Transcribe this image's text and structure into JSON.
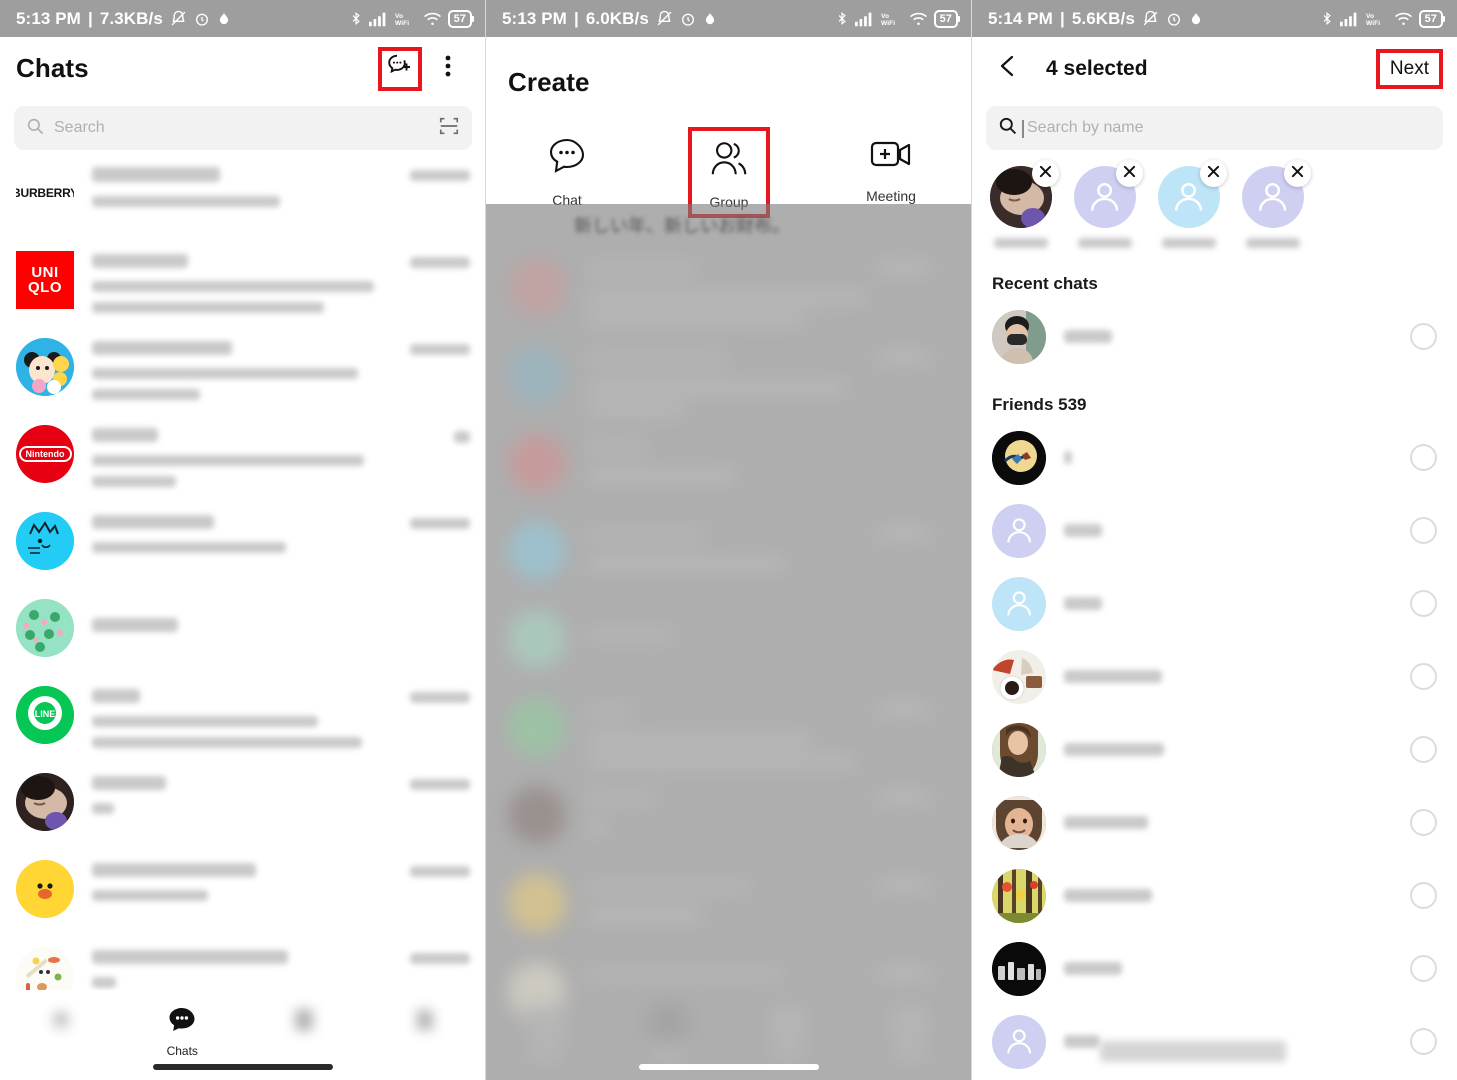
{
  "panels": [
    {
      "id": "chats",
      "status_bar": {
        "time": "5:13 PM",
        "separator": "|",
        "network_speed": "7.3KB/s",
        "icons_left": [
          "mute-bell-icon",
          "alarm-clock-icon",
          "data-saver-icon"
        ],
        "icons_right": [
          "bluetooth-icon",
          "signal-bars-icon",
          "vowifi-icon",
          "wifi-icon"
        ],
        "battery": "57"
      },
      "header": {
        "title": "Chats",
        "new_chat_icon": "new-chat-icon",
        "overflow_icon": "more-vertical-icon"
      },
      "search": {
        "placeholder": "Search",
        "search_icon": "search-icon",
        "scan_icon": "qr-scan-icon"
      },
      "chats": [
        {
          "avatar": "burberry-logo",
          "label": "BURBERRY",
          "lines": 2
        },
        {
          "avatar": "uniqlo-logo",
          "label": "UNI QLO",
          "lines": 3
        },
        {
          "avatar": "tsum-tsum-icon",
          "label": "",
          "lines": 3
        },
        {
          "avatar": "nintendo-logo",
          "label": "Nintendo",
          "lines": 3
        },
        {
          "avatar": "blue-cat-icon",
          "label": "",
          "lines": 2
        },
        {
          "avatar": "frog-pattern-icon",
          "label": "",
          "lines": 1
        },
        {
          "avatar": "line-logo",
          "label": "LINE",
          "lines": 3
        },
        {
          "avatar": "doll-photo",
          "label": "",
          "lines": 2
        },
        {
          "avatar": "yellow-duck-icon",
          "label": "",
          "lines": 2
        },
        {
          "avatar": "food-pattern-icon",
          "label": "",
          "lines": 2
        }
      ],
      "bottom_nav": [
        {
          "icon": "home-icon",
          "label": "",
          "active": false
        },
        {
          "icon": "chats-icon",
          "label": "Chats",
          "active": true
        },
        {
          "icon": "voom-icon",
          "label": "",
          "active": false
        },
        {
          "icon": "wallet-icon",
          "label": "",
          "active": false
        }
      ]
    },
    {
      "id": "create",
      "status_bar": {
        "time": "5:13 PM",
        "separator": "|",
        "network_speed": "6.0KB/s",
        "icons_left": [
          "mute-bell-icon",
          "alarm-clock-icon",
          "data-saver-icon"
        ],
        "icons_right": [
          "bluetooth-icon",
          "signal-bars-icon",
          "vowifi-icon",
          "wifi-icon"
        ],
        "battery": "57"
      },
      "header": {
        "title": "Create"
      },
      "tabs": [
        {
          "icon": "chat-bubble-icon",
          "label": "Chat",
          "highlighted": false
        },
        {
          "icon": "group-people-icon",
          "label": "Group",
          "highlighted": true
        },
        {
          "icon": "video-meeting-icon",
          "label": "Meeting",
          "highlighted": false
        }
      ],
      "background_text": "新しい年、新しいお財布。"
    },
    {
      "id": "select-members",
      "status_bar": {
        "time": "5:14 PM",
        "separator": "|",
        "network_speed": "5.6KB/s",
        "icons_left": [
          "mute-bell-icon",
          "alarm-clock-icon",
          "data-saver-icon"
        ],
        "icons_right": [
          "bluetooth-icon",
          "signal-bars-icon",
          "vowifi-icon",
          "wifi-icon"
        ],
        "battery": "57"
      },
      "header": {
        "back_icon": "back-chevron-icon",
        "title": "4 selected",
        "next_label": "Next"
      },
      "search": {
        "placeholder": "Search by name",
        "search_icon": "search-icon"
      },
      "selected_chips": [
        {
          "avatar": "doll-photo",
          "remove_icon": "close-icon"
        },
        {
          "avatar": "placeholder-purple",
          "remove_icon": "close-icon"
        },
        {
          "avatar": "placeholder-blue",
          "remove_icon": "close-icon"
        },
        {
          "avatar": "placeholder-purple",
          "remove_icon": "close-icon"
        }
      ],
      "sections": [
        {
          "title": "Recent chats",
          "people": [
            {
              "avatar": "masked-person-photo",
              "name_width": 48
            }
          ]
        },
        {
          "title": "Friends 539",
          "people": [
            {
              "avatar": "dark-moon-photo",
              "name_width": 8
            },
            {
              "avatar": "placeholder-purple",
              "name_width": 38
            },
            {
              "avatar": "placeholder-blue",
              "name_width": 38
            },
            {
              "avatar": "cafe-photo",
              "name_width": 98
            },
            {
              "avatar": "girl-brown-hair-photo",
              "name_width": 100
            },
            {
              "avatar": "smiling-girl-photo",
              "name_width": 84
            },
            {
              "avatar": "forest-photo",
              "name_width": 88
            },
            {
              "avatar": "black-night-photo",
              "name_width": 58
            },
            {
              "avatar": "placeholder-purple",
              "name_width": 36
            }
          ]
        }
      ]
    }
  ],
  "colors": {
    "highlight": "#e8161e",
    "status_bar_bg": "#9e9e9e",
    "accent_green": "#06c755",
    "uniqlo_red": "#ff0000",
    "nintendo_red": "#e60012"
  }
}
